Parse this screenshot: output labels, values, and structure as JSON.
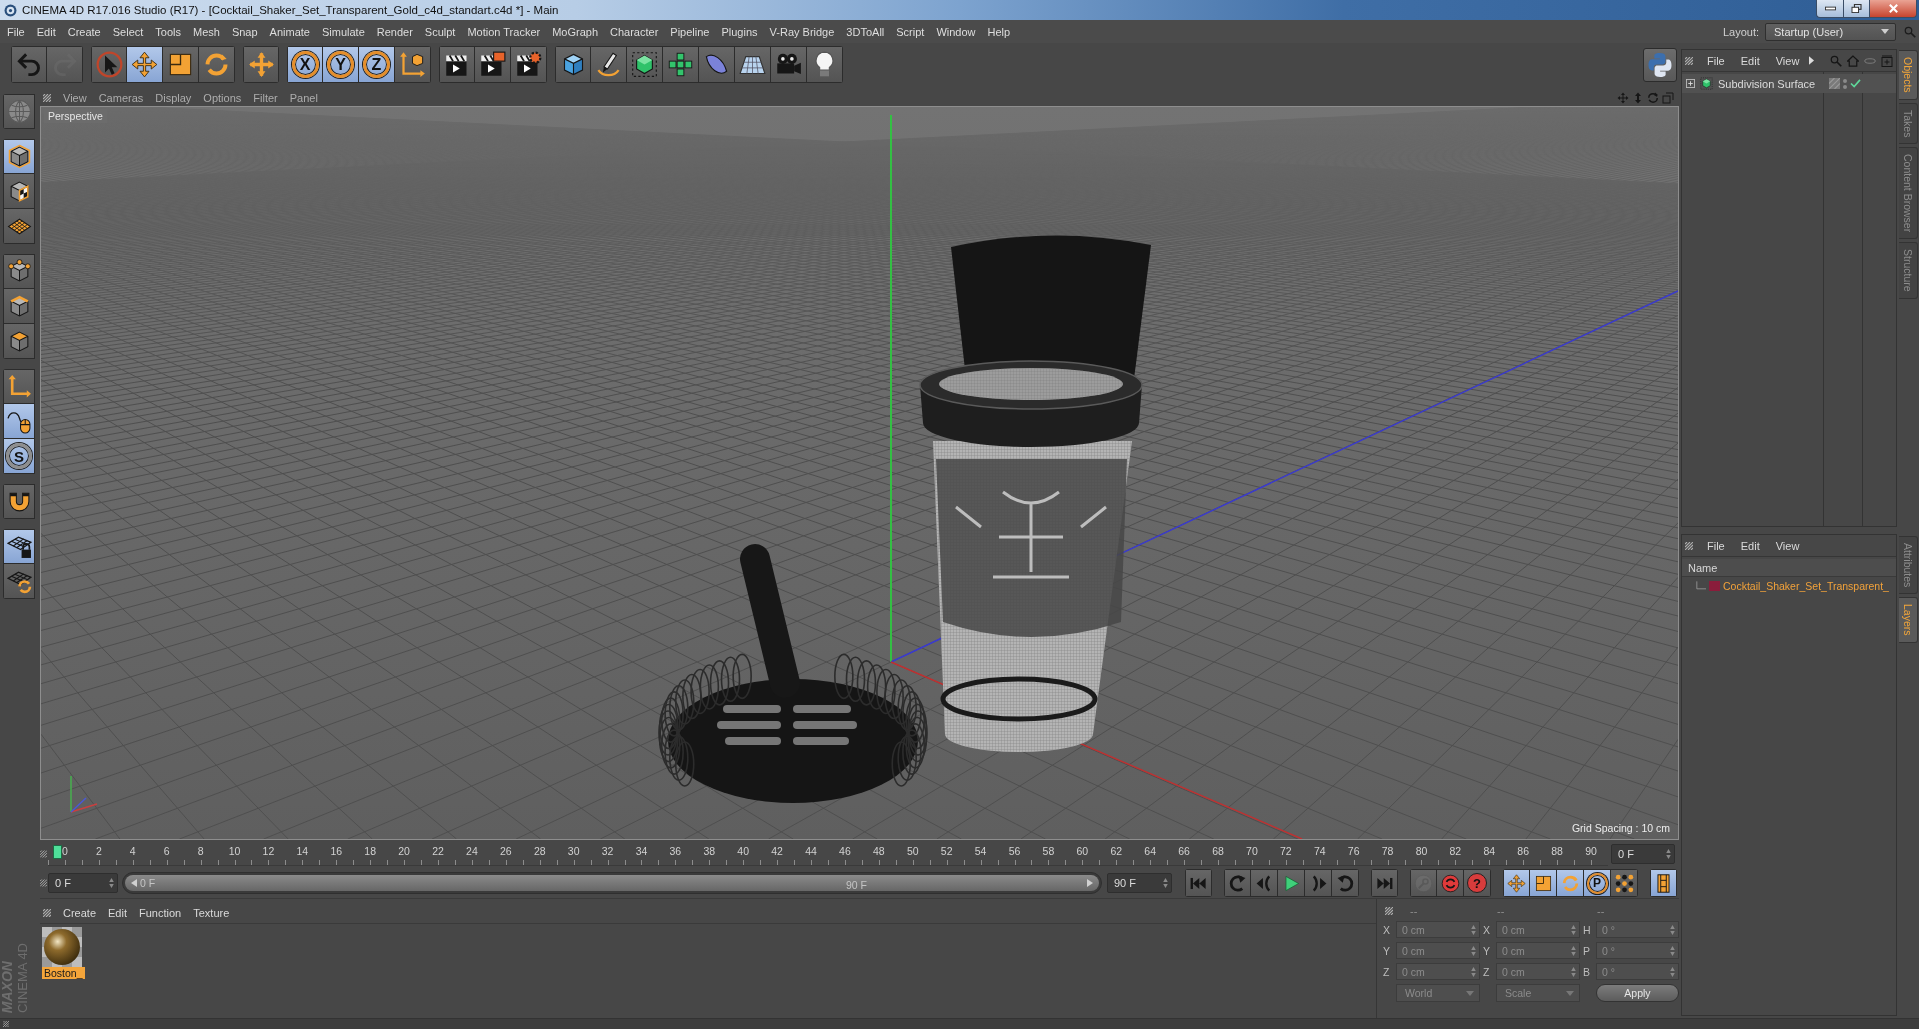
{
  "window": {
    "title": "CINEMA 4D R17.016 Studio (R17) - [Cocktail_Shaker_Set_Transparent_Gold_c4d_standart.c4d *] - Main"
  },
  "menu_bar": [
    "File",
    "Edit",
    "Create",
    "Select",
    "Tools",
    "Mesh",
    "Snap",
    "Animate",
    "Simulate",
    "Render",
    "Sculpt",
    "Motion Tracker",
    "MoGraph",
    "Character",
    "Pipeline",
    "Plugins",
    "V-Ray Bridge",
    "3DToAll",
    "Script",
    "Window",
    "Help"
  ],
  "layout": {
    "label": "Layout:",
    "value": "Startup (User)"
  },
  "toolbar": [
    [
      {
        "kind": "icon",
        "on": false,
        "disabled": false
      },
      {
        "kind": "icon",
        "on": false,
        "disabled": true
      }
    ],
    [
      {
        "kind": "icon",
        "on": false,
        "disabled": false
      },
      {
        "kind": "icon",
        "on": true,
        "disabled": false
      },
      {
        "kind": "icon",
        "on": false,
        "disabled": false
      },
      {
        "kind": "icon",
        "on": false,
        "disabled": false
      }
    ],
    [
      {
        "kind": "icon",
        "on": false,
        "disabled": false
      }
    ],
    [
      {
        "kind": "letter",
        "label": "X",
        "on": true,
        "disabled": false
      },
      {
        "kind": "letter",
        "label": "Y",
        "on": true,
        "disabled": false
      },
      {
        "kind": "letter",
        "label": "Z",
        "on": true,
        "disabled": false
      },
      {
        "kind": "icon",
        "on": false,
        "disabled": false
      }
    ],
    [
      {
        "kind": "icon",
        "on": false,
        "disabled": false
      },
      {
        "kind": "icon",
        "on": false,
        "disabled": false
      },
      {
        "kind": "icon",
        "on": false,
        "disabled": false
      }
    ],
    [
      {
        "kind": "icon",
        "on": false,
        "disabled": false
      },
      {
        "kind": "icon",
        "on": false,
        "disabled": false
      },
      {
        "kind": "icon",
        "on": false,
        "disabled": false
      },
      {
        "kind": "icon",
        "on": false,
        "disabled": false
      },
      {
        "kind": "icon",
        "on": false,
        "disabled": false
      },
      {
        "kind": "icon",
        "on": false,
        "disabled": false
      },
      {
        "kind": "icon",
        "on": false,
        "disabled": false
      },
      {
        "kind": "icon",
        "on": false,
        "disabled": false
      }
    ]
  ],
  "mode_palette": [
    [
      {
        "kind": "icon",
        "on": false
      }
    ],
    [
      {
        "kind": "icon",
        "on": true
      },
      {
        "kind": "icon",
        "on": false
      },
      {
        "kind": "icon",
        "on": false
      }
    ],
    [
      {
        "kind": "icon",
        "on": false
      },
      {
        "kind": "icon",
        "on": false
      },
      {
        "kind": "icon",
        "on": false
      }
    ],
    [
      {
        "kind": "icon",
        "on": false
      },
      {
        "kind": "icon",
        "on": true
      },
      {
        "kind": "letter",
        "label": "S",
        "on": true
      }
    ],
    [
      {
        "kind": "icon",
        "on": false
      }
    ],
    [
      {
        "kind": "icon",
        "on": true
      },
      {
        "kind": "icon",
        "on": false
      }
    ]
  ],
  "viewport": {
    "menu": [
      "View",
      "Cameras",
      "Display",
      "Options",
      "Filter",
      "Panel"
    ],
    "camera": "Perspective",
    "grid_spacing": "Grid Spacing : 10 cm"
  },
  "timeline": {
    "frames": [
      "0",
      "2",
      "4",
      "6",
      "8",
      "10",
      "12",
      "14",
      "16",
      "18",
      "20",
      "22",
      "24",
      "26",
      "28",
      "30",
      "32",
      "34",
      "36",
      "38",
      "40",
      "42",
      "44",
      "46",
      "48",
      "50",
      "52",
      "54",
      "56",
      "58",
      "60",
      "62",
      "64",
      "66",
      "68",
      "70",
      "72",
      "74",
      "76",
      "78",
      "80",
      "82",
      "84",
      "86",
      "88",
      "90"
    ],
    "level": 0,
    "current_frame": "0 F",
    "start_field": "0 F",
    "range": {
      "level": 1,
      "start": "0 F",
      "end": "90 F"
    },
    "end_field": "90 F"
  },
  "transport": [
    [
      {
        "kind": "icon",
        "on": false,
        "disabled": false
      }
    ],
    [
      {
        "kind": "icon",
        "on": false,
        "disabled": false
      },
      {
        "kind": "icon",
        "on": false,
        "disabled": false
      },
      {
        "kind": "icon",
        "on": false,
        "disabled": false
      },
      {
        "kind": "icon",
        "on": false,
        "disabled": false
      },
      {
        "kind": "icon",
        "on": false,
        "disabled": false
      }
    ],
    [
      {
        "kind": "icon",
        "on": false,
        "disabled": false
      }
    ],
    [
      {
        "kind": "icon",
        "on": false,
        "disabled": true
      },
      {
        "kind": "icon",
        "on": false,
        "disabled": false
      },
      {
        "kind": "badge",
        "label": "?",
        "on": false,
        "disabled": false
      }
    ],
    [
      {
        "kind": "icon",
        "on": true,
        "disabled": false
      },
      {
        "kind": "icon",
        "on": true,
        "disabled": false
      },
      {
        "kind": "icon",
        "on": true,
        "disabled": false
      },
      {
        "kind": "letter",
        "label": "P",
        "on": true,
        "disabled": false
      },
      {
        "kind": "icon",
        "on": false,
        "disabled": false
      }
    ],
    [
      {
        "kind": "icon",
        "on": true,
        "disabled": false
      }
    ]
  ],
  "material_manager": {
    "menu": [
      "Create",
      "Edit",
      "Function",
      "Texture"
    ],
    "materials": [
      {
        "name": "Boston_",
        "selected": true
      }
    ]
  },
  "coordinates": {
    "headers": [
      "--",
      "--",
      "--"
    ],
    "rows": [
      {
        "cells": [
          {
            "axis": "X",
            "value": "0 cm"
          },
          {
            "axis": "X",
            "value": "0 cm"
          },
          {
            "axis": "H",
            "value": "0 °"
          }
        ]
      },
      {
        "cells": [
          {
            "axis": "Y",
            "value": "0 cm"
          },
          {
            "axis": "Y",
            "value": "0 cm"
          },
          {
            "axis": "P",
            "value": "0 °"
          }
        ]
      },
      {
        "cells": [
          {
            "axis": "Z",
            "value": "0 cm"
          },
          {
            "axis": "Z",
            "value": "0 cm"
          },
          {
            "axis": "B",
            "value": "0 °"
          }
        ]
      }
    ],
    "dropdowns": [
      "World",
      "Scale"
    ],
    "apply": "Apply"
  },
  "object_manager": {
    "menu": [
      "File",
      "Edit",
      "View"
    ],
    "objects": [
      {
        "name": "Subdivision Surface",
        "expanded": false,
        "enabled": true
      }
    ]
  },
  "layer_manager": {
    "menu": [
      "File",
      "Edit",
      "View"
    ],
    "column": "Name",
    "layers": [
      {
        "name": "Cocktail_Shaker_Set_Transparent_",
        "color": "#8a1d3b"
      }
    ]
  },
  "side_tabs": [
    {
      "label": "Objects",
      "selected": true
    },
    {
      "label": "Takes",
      "selected": false
    },
    {
      "label": "Content Browser",
      "selected": false
    },
    {
      "label": "Structure",
      "selected": false
    }
  ],
  "lower_tabs": [
    {
      "label": "Attributes",
      "selected": false
    },
    {
      "label": "Layers",
      "selected": true
    }
  ],
  "logo": {
    "brand": "MAXON",
    "product": "CINEMA 4D"
  }
}
